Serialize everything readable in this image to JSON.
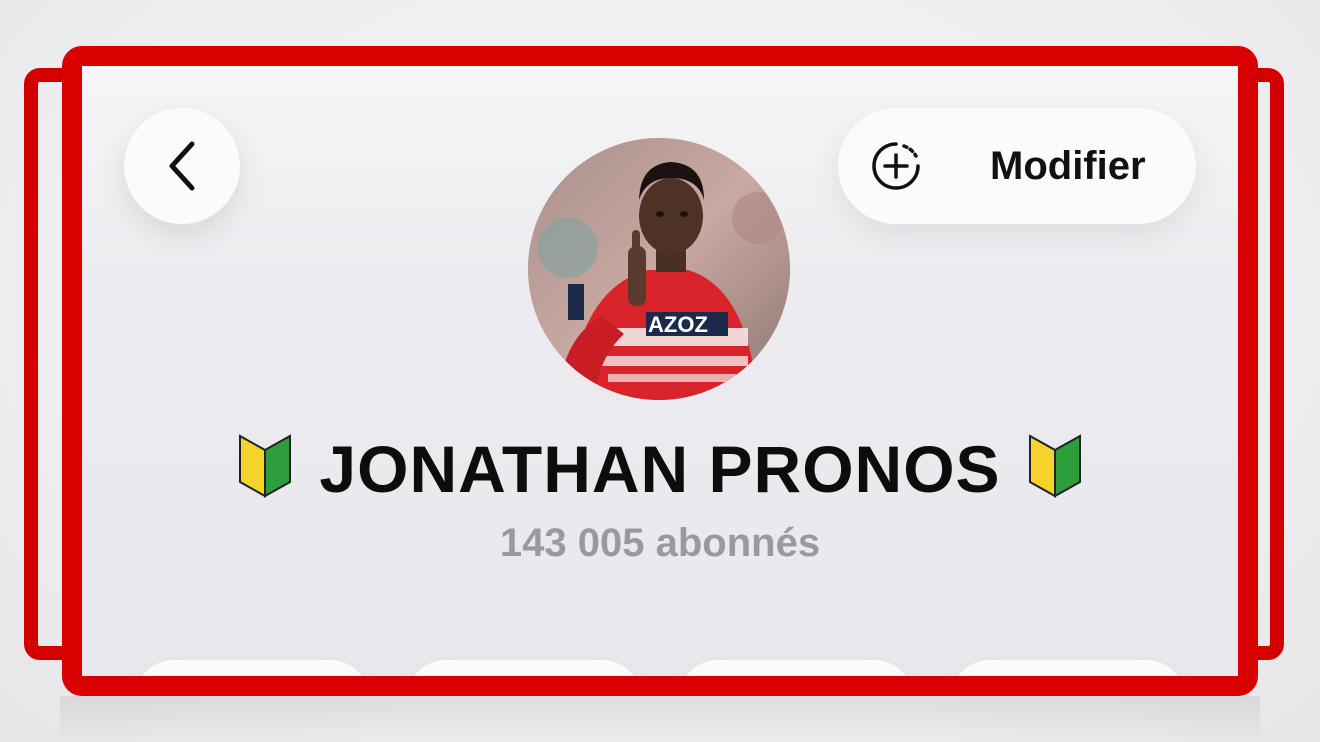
{
  "header": {
    "back_icon": "chevron-left-icon",
    "modify_icon": "add-circle-icon",
    "modify_label": "Modifier"
  },
  "profile": {
    "name": "JONATHAN PRONOS",
    "name_emoji": "beginner-leaf-icon",
    "followers": "143 005 abonnés",
    "avatar": "avatar-photo"
  },
  "colors": {
    "frame_red": "#d80000",
    "followers_gray": "#9a9a9e"
  }
}
